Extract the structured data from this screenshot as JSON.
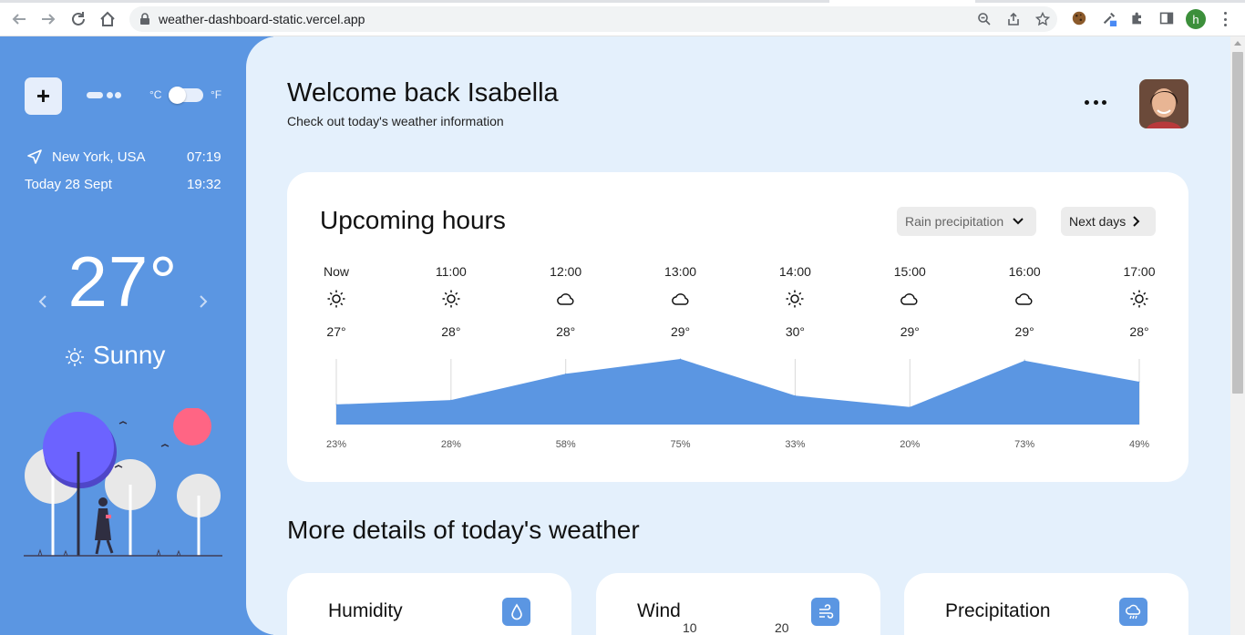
{
  "browser": {
    "url": "weather-dashboard-static.vercel.app",
    "profile_initial": "h"
  },
  "sidebar": {
    "unit_celsius": "°C",
    "unit_fahrenheit": "°F",
    "unit_toggle_value": "°C",
    "location": "New York, USA",
    "location_time": "07:19",
    "date": "Today 28 Sept",
    "date_time": "19:32",
    "current_temp": "27°",
    "condition": "Sunny",
    "condition_icon": "sun-icon"
  },
  "header": {
    "title": "Welcome back Isabella",
    "subtitle": "Check out today's weather information"
  },
  "upcoming": {
    "title": "Upcoming hours",
    "dropdown_label": "Rain precipitation",
    "next_label": "Next days",
    "hours": [
      {
        "time": "Now",
        "icon": "sun-icon",
        "temp": "27°",
        "rain": "23%"
      },
      {
        "time": "11:00",
        "icon": "sun-icon",
        "temp": "28°",
        "rain": "28%"
      },
      {
        "time": "12:00",
        "icon": "cloud-icon",
        "temp": "28°",
        "rain": "58%"
      },
      {
        "time": "13:00",
        "icon": "cloud-icon",
        "temp": "29°",
        "rain": "75%"
      },
      {
        "time": "14:00",
        "icon": "sun-icon",
        "temp": "30°",
        "rain": "33%"
      },
      {
        "time": "15:00",
        "icon": "cloud-icon",
        "temp": "29°",
        "rain": "20%"
      },
      {
        "time": "16:00",
        "icon": "cloud-icon",
        "temp": "29°",
        "rain": "73%"
      },
      {
        "time": "17:00",
        "icon": "sun-icon",
        "temp": "28°",
        "rain": "49%"
      }
    ],
    "accent_color": "#5b96e2"
  },
  "chart_data": {
    "type": "area",
    "categories": [
      "Now",
      "11:00",
      "12:00",
      "13:00",
      "14:00",
      "15:00",
      "16:00",
      "17:00"
    ],
    "values": [
      23,
      28,
      58,
      75,
      33,
      20,
      73,
      49
    ],
    "ylim": [
      0,
      100
    ],
    "grid": true
  },
  "details": {
    "title": "More details of today's weather",
    "cards": [
      {
        "label": "Humidity",
        "icon": "droplet-icon"
      },
      {
        "label": "Wind",
        "icon": "wind-icon",
        "gauge_ticks": [
          "10",
          "20"
        ]
      },
      {
        "label": "Precipitation",
        "icon": "rain-cloud-icon"
      }
    ]
  },
  "colors": {
    "sidebar": "#5b96e2",
    "main_bg": "#e4f0fc",
    "card_bg": "#ffffff"
  }
}
